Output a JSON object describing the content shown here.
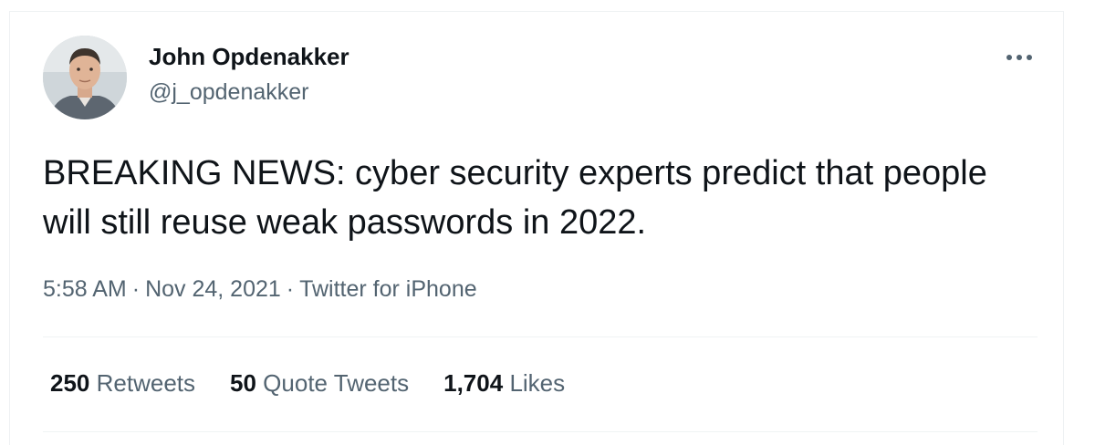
{
  "author": {
    "name": "John Opdenakker",
    "handle": "@j_opdenakker"
  },
  "tweet": {
    "text": "BREAKING NEWS: cyber security experts predict that people will still reuse weak passwords in 2022.",
    "time": "5:58 AM",
    "date": "Nov 24, 2021",
    "source": "Twitter for iPhone",
    "separator": "·"
  },
  "stats": {
    "retweets": {
      "count": "250",
      "label": "Retweets"
    },
    "quote_tweets": {
      "count": "50",
      "label": "Quote Tweets"
    },
    "likes": {
      "count": "1,704",
      "label": "Likes"
    }
  },
  "icons": {
    "more": "more-horizontal-icon"
  },
  "colors": {
    "text_primary": "#0f1419",
    "text_secondary": "#536471",
    "divider": "#eff3f4"
  }
}
